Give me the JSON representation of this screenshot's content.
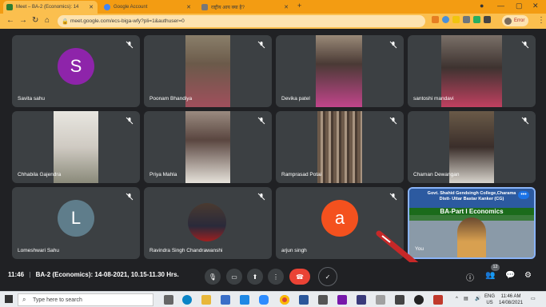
{
  "browser": {
    "tabs": [
      {
        "title": "Meet – BA-2 (Economics): 14",
        "color": "#2e7d32"
      },
      {
        "title": "Google Account",
        "color": "#4285f4"
      },
      {
        "title": "राष्ट्रीय आय क्या है?",
        "color": "#777777"
      }
    ],
    "url": "meet.google.com/ecs-biga-wfy?pli=1&authuser=0",
    "profile_label": "Error"
  },
  "participants": [
    {
      "name": "Savita sahu",
      "initial": "S",
      "avatar_color": "#8e24aa"
    },
    {
      "name": "Poonam Bhandiya"
    },
    {
      "name": "Devika patel"
    },
    {
      "name": "santoshi mandavi"
    },
    {
      "name": "Chhabila Gajendra"
    },
    {
      "name": "Priya Mahla"
    },
    {
      "name": "Ramprasad Potai"
    },
    {
      "name": "Chaman Dewangan"
    },
    {
      "name": "Lomeshwari Sahu",
      "initial": "L",
      "avatar_color": "#5f7d8b"
    },
    {
      "name": "Ravindra Singh Chandrawanshi"
    },
    {
      "name": "arjun singh",
      "initial": "a",
      "avatar_color": "#f4511e"
    },
    {
      "name": "You",
      "banner_line1": "Govt. Shahid Gendsingh College,Charama",
      "banner_line2": "Distt- Uttar Bastar Kanker (CG)",
      "banner_line3": "BA-Part I Economics"
    }
  ],
  "meeting": {
    "time": "11:46",
    "title": "BA-2 (Economics): 14-08-2021, 10.15-11.30 Hrs.",
    "people_count": "12"
  },
  "taskbar": {
    "search_placeholder": "Type here to search",
    "lang": "ENG",
    "region": "US",
    "clock": "11:46 AM",
    "date": "14/08/2021"
  }
}
